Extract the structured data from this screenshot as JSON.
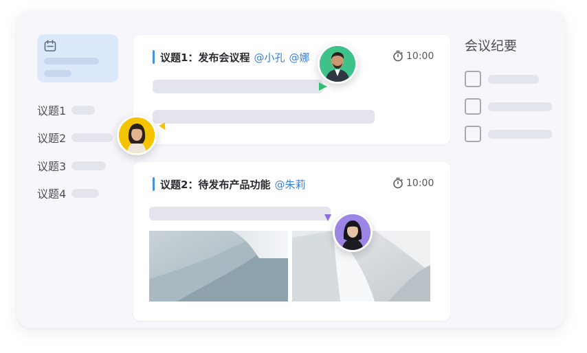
{
  "sidebar": {
    "items": [
      {
        "label": "议题1"
      },
      {
        "label": "议题2"
      },
      {
        "label": "议题3"
      },
      {
        "label": "议题4"
      }
    ]
  },
  "topics": [
    {
      "title": "议题1：发布会议程",
      "mentions": [
        "@小孔",
        "@娜"
      ],
      "time": "10:00"
    },
    {
      "title": "议题2：待发布产品功能",
      "mentions": [
        "@朱莉"
      ],
      "time": "10:00"
    }
  ],
  "notes": {
    "title": "会议纪要"
  },
  "colors": {
    "accent": "#3b7fd6",
    "green_pointer": "#2fbf71",
    "yellow_pointer": "#f5c400",
    "purple_pointer": "#8e6de0",
    "calendar_card": "#dbe9fb"
  },
  "icons": [
    "calendar-icon",
    "stopwatch-icon",
    "checkbox-icon"
  ]
}
